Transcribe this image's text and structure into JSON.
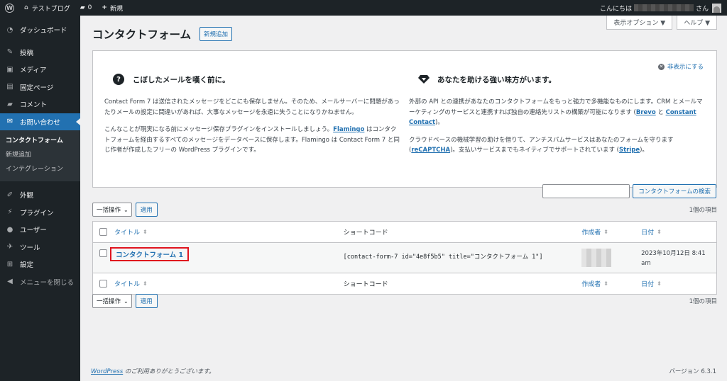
{
  "admin_bar": {
    "site_name": "テストブログ",
    "comments_count": "0",
    "new_label": "新規",
    "greeting": "こんにちは",
    "greeting_suffix": "さん"
  },
  "sidebar": {
    "items": [
      {
        "label": "ダッシュボード",
        "icon": "dashboard-icon"
      },
      {
        "label": "投稿",
        "icon": "pin-icon"
      },
      {
        "label": "メディア",
        "icon": "media-icon"
      },
      {
        "label": "固定ページ",
        "icon": "page-icon"
      },
      {
        "label": "コメント",
        "icon": "comment-icon"
      },
      {
        "label": "お問い合わせ",
        "icon": "mail-icon"
      }
    ],
    "submenu": [
      "コンタクトフォーム",
      "新規追加",
      "インテグレーション"
    ],
    "items2": [
      {
        "label": "外観",
        "icon": "brush-icon"
      },
      {
        "label": "プラグイン",
        "icon": "plugin-icon"
      },
      {
        "label": "ユーザー",
        "icon": "user-icon"
      },
      {
        "label": "ツール",
        "icon": "wrench-icon"
      },
      {
        "label": "設定",
        "icon": "settings-icon"
      }
    ],
    "collapse_label": "メニューを閉じる"
  },
  "header": {
    "screen_options": "表示オプション ▼",
    "help": "ヘルプ ▼",
    "title": "コンタクトフォーム",
    "add_new": "新規追加"
  },
  "welcome": {
    "dismiss": "非表示にする",
    "left_heading": "こぼしたメールを嘆く前に。",
    "left_p1": "Contact Form 7 は送信されたメッセージをどこにも保存しません。そのため、メールサーバーに問題があったりメールの設定に間違いがあれば、大事なメッセージを永遠に失うことになりかねません。",
    "left_p2_a": "こんなことが現実になる前にメッセージ保存プラグインをインストールしましょう。",
    "left_p2_link": "Flamingo",
    "left_p2_b": " はコンタクトフォームを経由するすべてのメッセージをデータベースに保存します。Flamingo は Contact Form 7 と同じ作者が作成したフリーの WordPress プラグインです。",
    "right_heading": "あなたを助ける強い味方がいます。",
    "right_p1_a": "外部の API との連携があなたのコンタクトフォームをもっと強力で多機能なものにします。CRM とメールマーケティングのサービスと連携すれば独自の連絡先リストの構築が可能になります (",
    "right_p1_link1": "Brevo",
    "right_p1_mid": " と ",
    "right_p1_link2": "Constant Contact",
    "right_p1_b": ")。",
    "right_p2_a": "クラウドベースの機械学習の助けを借りて、アンチスパムサービスはあなたのフォームを守ります (",
    "right_p2_link1": "reCAPTCHA",
    "right_p2_mid": ")。支払いサービスまでもネイティブでサポートされています (",
    "right_p2_link2": "Stripe",
    "right_p2_b": ")。"
  },
  "search": {
    "button": "コンタクトフォームの検索",
    "value": ""
  },
  "tablenav": {
    "bulk_label": "一括操作",
    "apply": "適用",
    "count": "1個の項目"
  },
  "table": {
    "col_title": "タイトル",
    "col_shortcode": "ショートコード",
    "col_author": "作成者",
    "col_date": "日付",
    "rows": [
      {
        "title": "コンタクトフォーム 1",
        "shortcode": "[contact-form-7 id=\"4e8f5b5\" title=\"コンタクトフォーム 1\"]",
        "date_line1": "2023年10月12日 8:41",
        "date_line2": "am"
      }
    ]
  },
  "footer": {
    "wp_link": "WordPress",
    "thanks": " のご利用ありがとうございます。",
    "version": "バージョン 6.3.1"
  },
  "colors": {
    "admin_dark": "#1d2327",
    "accent_blue": "#2271b1",
    "highlight_red": "#e0141e"
  }
}
